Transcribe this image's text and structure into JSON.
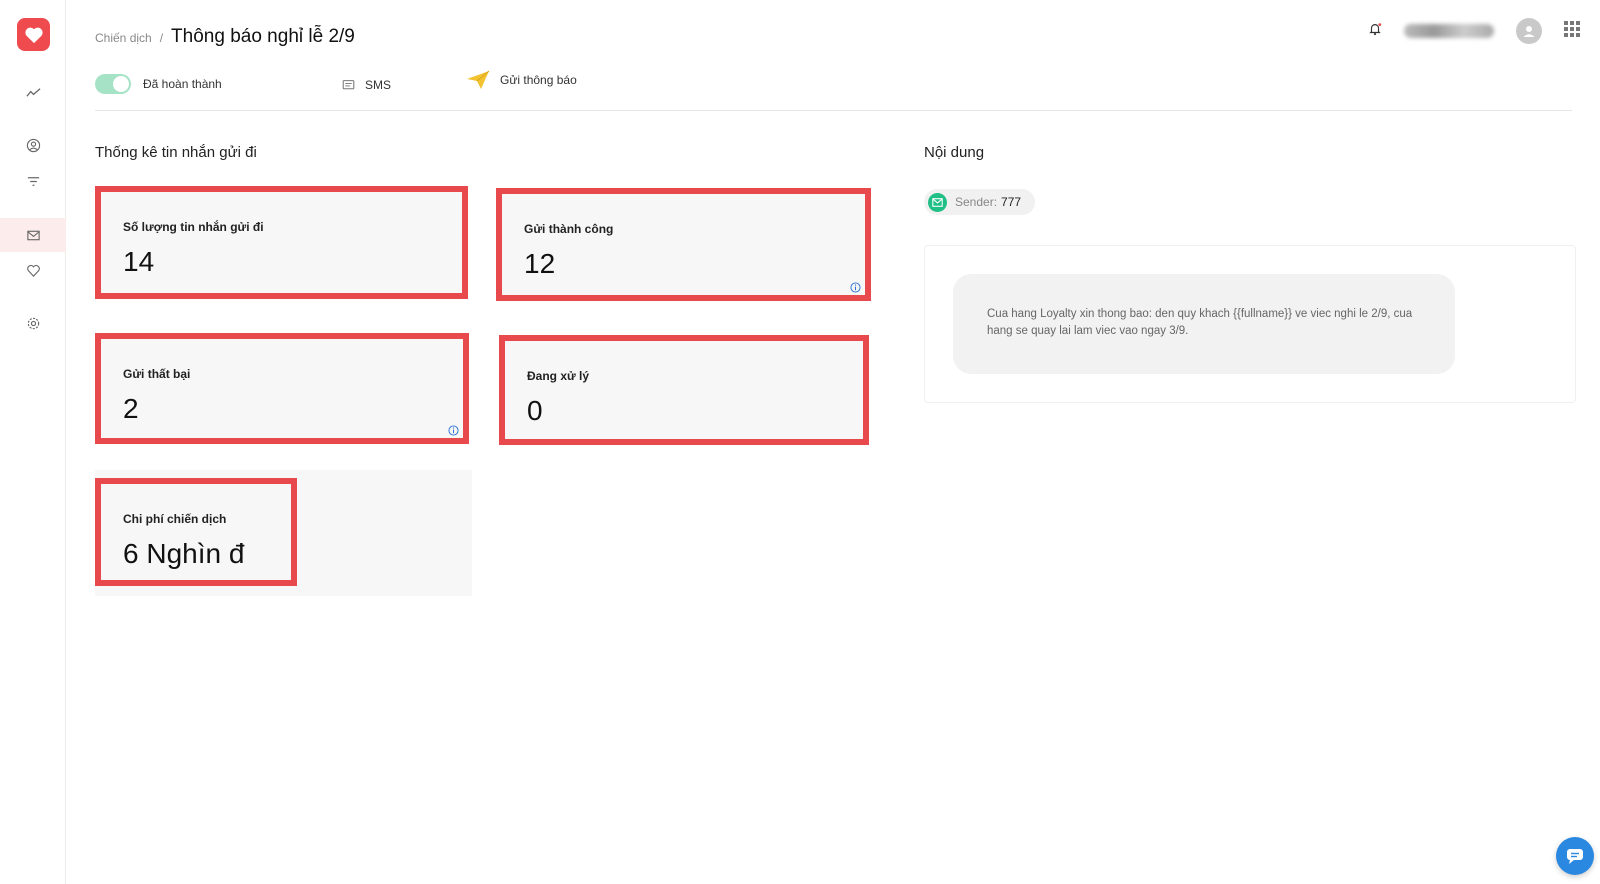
{
  "breadcrumb": {
    "parent": "Chiến dịch",
    "separator": "/",
    "title": "Thông báo nghỉ lễ 2/9"
  },
  "status": {
    "label": "Đã hoàn thành",
    "enabled": true
  },
  "channel": {
    "label": "SMS"
  },
  "actions": {
    "send_label": "Gửi thông báo"
  },
  "stats": {
    "title": "Thống kê tin nhắn gửi đi",
    "sent": {
      "label": "Số lượng tin nhắn gửi đi",
      "value": "14"
    },
    "success": {
      "label": "Gửi thành công",
      "value": "12"
    },
    "failed": {
      "label": "Gửi thất bại",
      "value": "2"
    },
    "processing": {
      "label": "Đang xử lý",
      "value": "0"
    },
    "cost": {
      "label": "Chi phí chiến dịch",
      "value": "6 Nghìn đ"
    }
  },
  "content": {
    "title": "Nội dung",
    "sender_label": "Sender:",
    "sender_value": "777",
    "message": "Cua hang Loyalty xin thong bao: den quy khach {{fullname}} ve viec nghi le 2/9, cua hang se quay lai lam viec vao ngay 3/9."
  },
  "icons": {
    "logo": "heart-icon",
    "nav": [
      "trending-icon",
      "user-circle-icon",
      "filter-icon",
      "mail-icon",
      "heart-outline-icon",
      "gear-icon"
    ],
    "top": [
      "bell-icon",
      "avatar-icon",
      "apps-grid-icon"
    ],
    "chat": "chat-icon"
  },
  "colors": {
    "accent": "#e8494d",
    "toggle_on": "#a6e3c6",
    "sender": "#1fbf86",
    "chat": "#2b88e0",
    "send_icon": "#f2c230"
  }
}
